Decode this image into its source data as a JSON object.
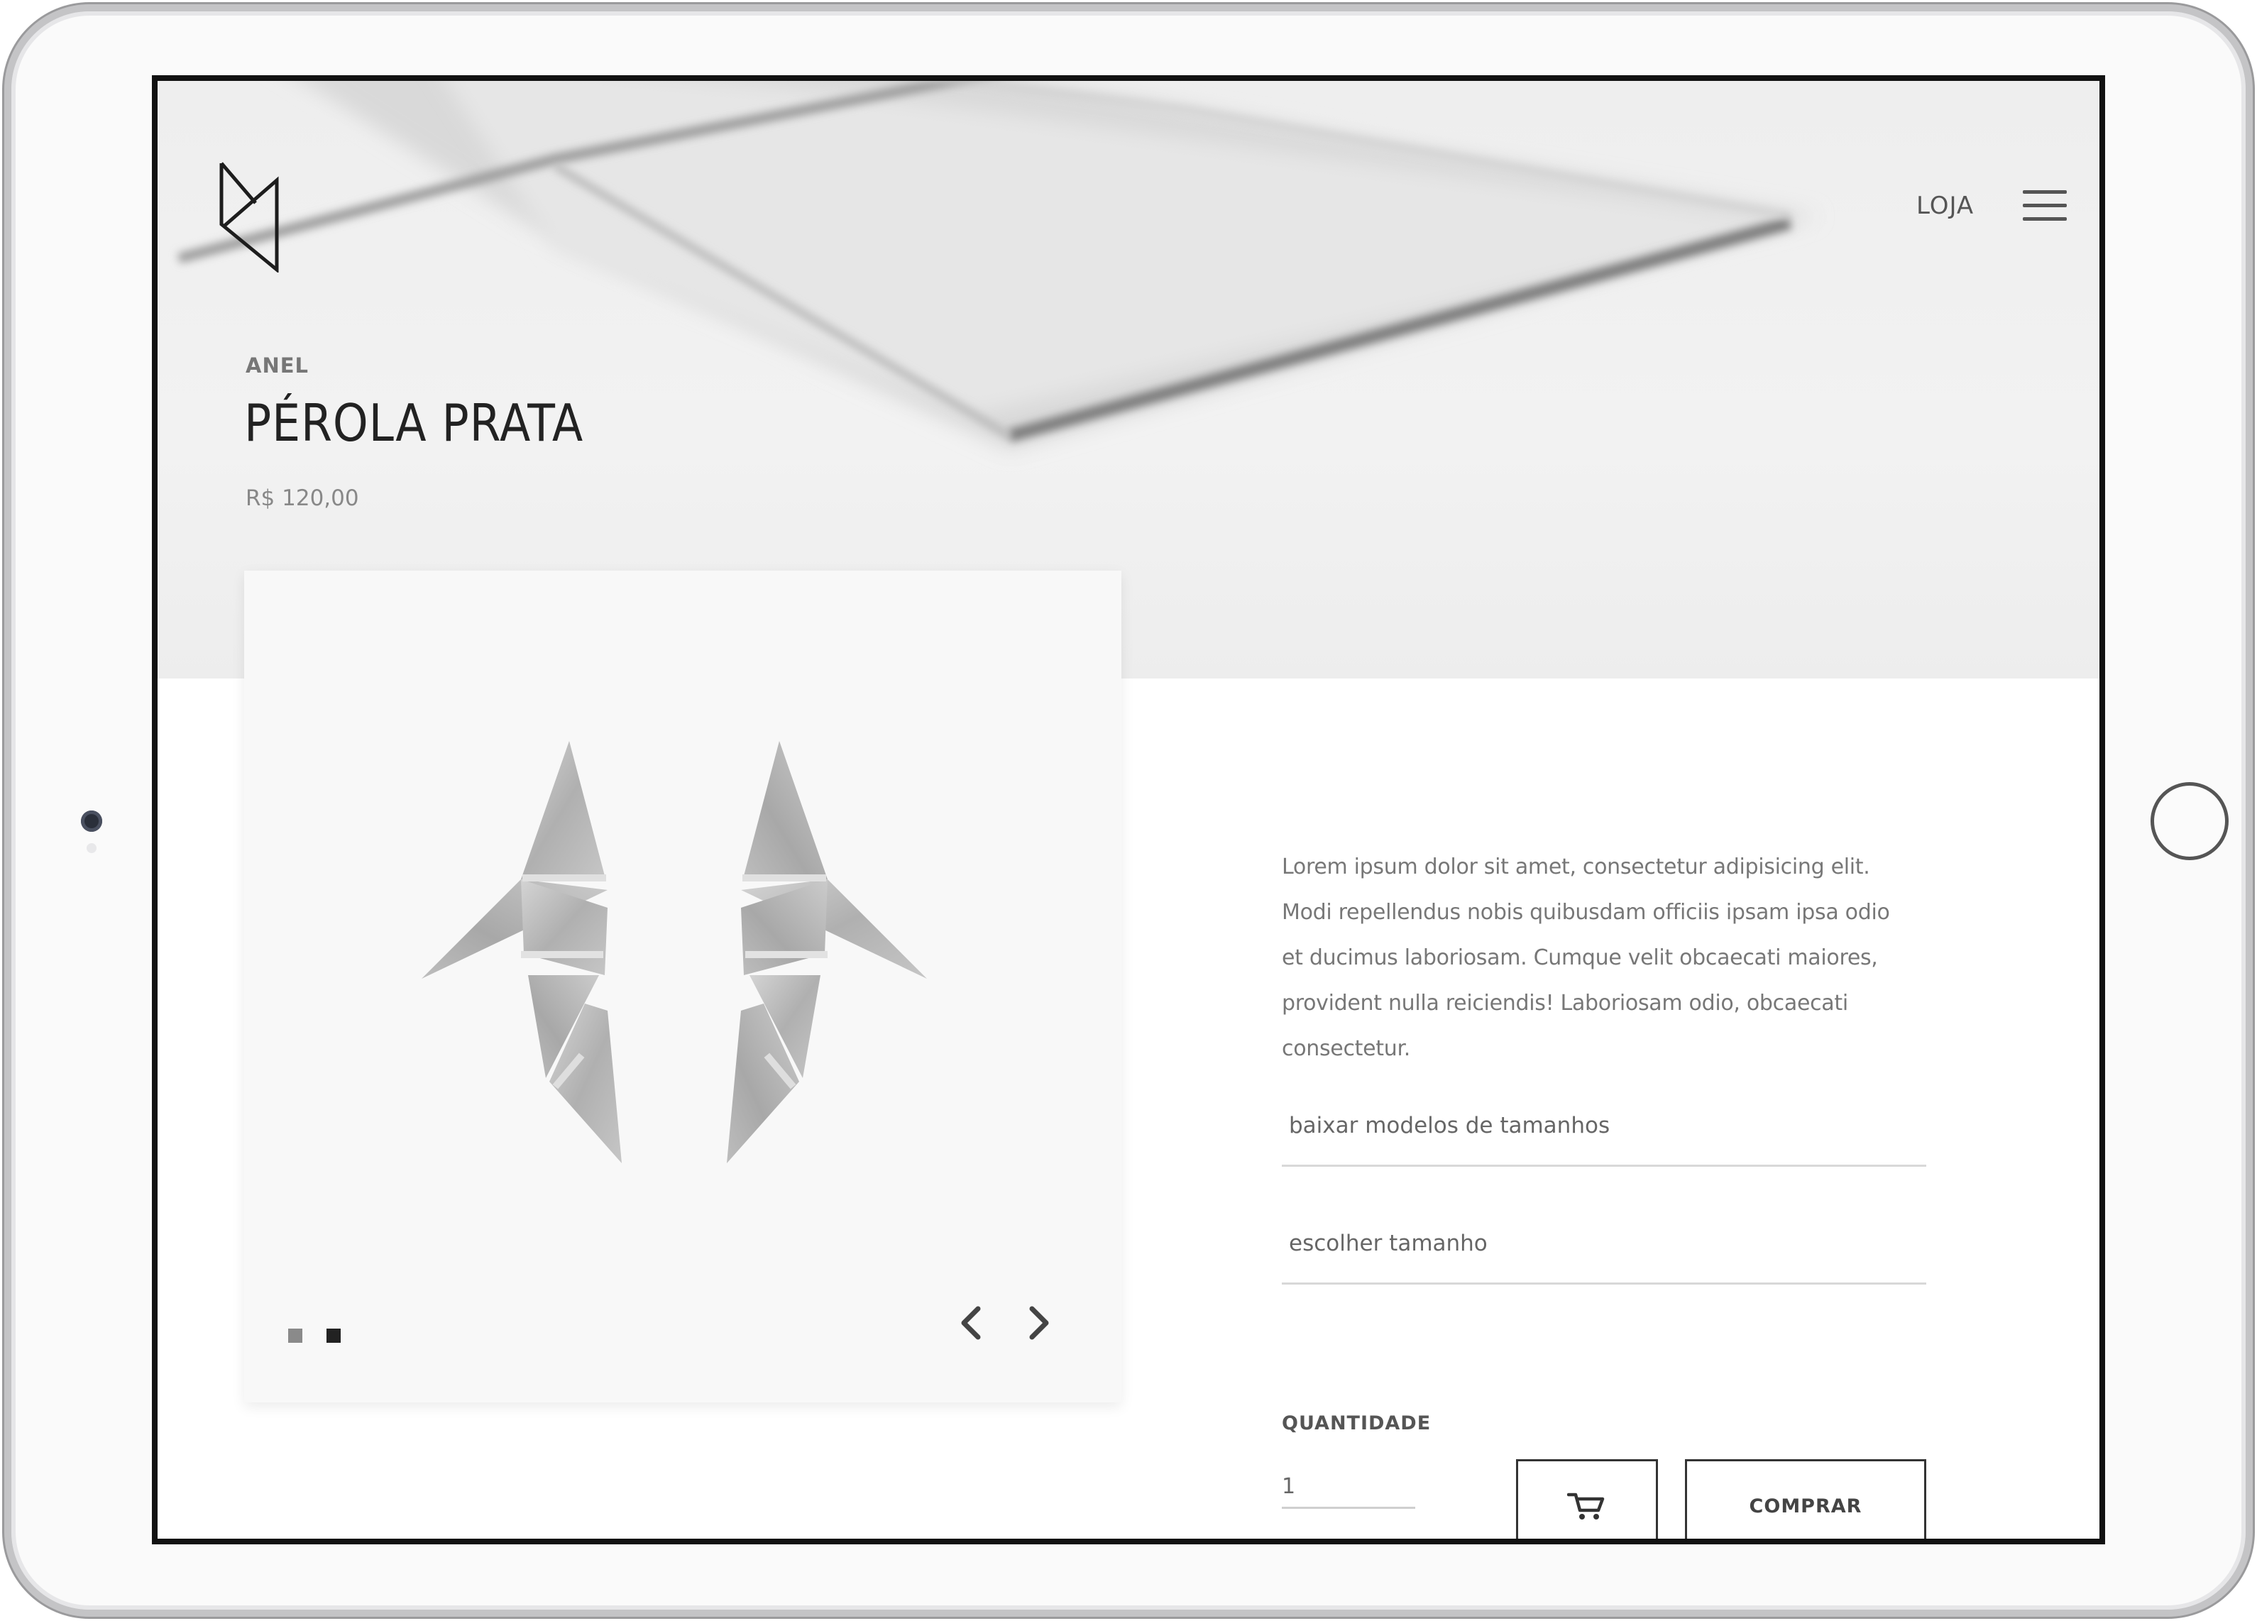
{
  "nav": {
    "shop_label": "LOJA"
  },
  "product": {
    "category": "ANEL",
    "title": "PÉROLA PRATA",
    "price": "R$ 120,00",
    "description": "Lorem ipsum dolor sit amet, consectetur adipisicing elit. Modi repellendus nobis quibusdam officiis ipsam ipsa odio et ducimus laboriosam. Cumque velit obcaecati maiores, provident nulla reiciendis! Laboriosam odio, obcaecati consectetur."
  },
  "options": {
    "size_models_label": "baixar modelos de tamanhos",
    "choose_size_label": "escolher tamanho"
  },
  "purchase": {
    "quantity_label": "QUANTIDADE",
    "quantity_value": "1",
    "buy_label": "COMPRAR"
  },
  "gallery": {
    "slide_count": 2,
    "active_slide": 2
  },
  "colors": {
    "text_dark": "#222222",
    "text_muted": "#777777",
    "hero_bg": "#eeeeee",
    "border": "#333333"
  }
}
